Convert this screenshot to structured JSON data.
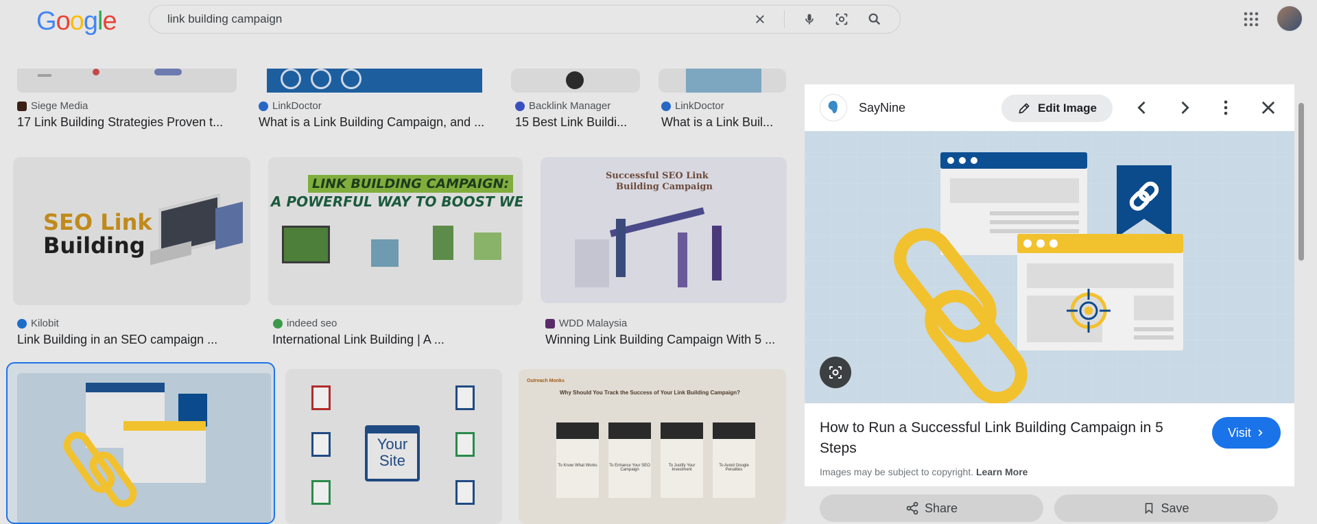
{
  "search": {
    "query": "link building campaign"
  },
  "row1": [
    {
      "source": "Siege Media",
      "title": "17 Link Building Strategies Proven t..."
    },
    {
      "source": "LinkDoctor",
      "title": "What is a Link Building Campaign, and ..."
    },
    {
      "source": "Backlink Manager",
      "title": "15 Best Link Buildi..."
    },
    {
      "source": "LinkDoctor",
      "title": "What is a Link Buil..."
    }
  ],
  "row2": [
    {
      "source": "Kilobit",
      "title": "Link Building in an SEO campaign ...",
      "img_text1": "SEO Link",
      "img_text2": "Building"
    },
    {
      "source": "indeed seo",
      "title": "International Link Building | A ...",
      "img_text1": "LINK BUILDING CAMPAIGN:",
      "img_text2": "A POWERFUL WAY TO BOOST WEBSITE"
    },
    {
      "source": "WDD Malaysia",
      "title": "Winning Link Building Campaign With 5 ...",
      "img_text1": "Successful SEO Link",
      "img_text2": "Building Campaign"
    }
  ],
  "row3": {
    "diagram_text1": "Your",
    "diagram_text2": "Site",
    "outreach_title": "Why Should You Track the Success of Your Link Building Campaign?",
    "outreach_brand": "Outreach Monks",
    "outreach_items": [
      "To Know What Works",
      "To Enhance Your SEO Campaign",
      "To Justify Your Investment",
      "To Avoid Google Penalties"
    ]
  },
  "panel": {
    "site_name": "SayNine",
    "edit_label": "Edit Image",
    "title": "How to Run a Successful Link Building Campaign in 5 Steps",
    "visit_label": "Visit",
    "copyright": "Images may be subject to copyright.",
    "learn_more": "Learn More",
    "share_label": "Share",
    "save_label": "Save"
  },
  "colors": {
    "accent": "#1a73e8",
    "navy": "#0b4a8b",
    "yellow": "#f2c12e"
  },
  "icons": [
    "google-logo",
    "clear-icon",
    "mic-icon",
    "lens-icon",
    "search-icon",
    "apps-icon",
    "pencil-icon",
    "chevron-left-icon",
    "chevron-right-icon",
    "more-vert-icon",
    "close-icon",
    "share-icon",
    "bookmark-icon"
  ]
}
